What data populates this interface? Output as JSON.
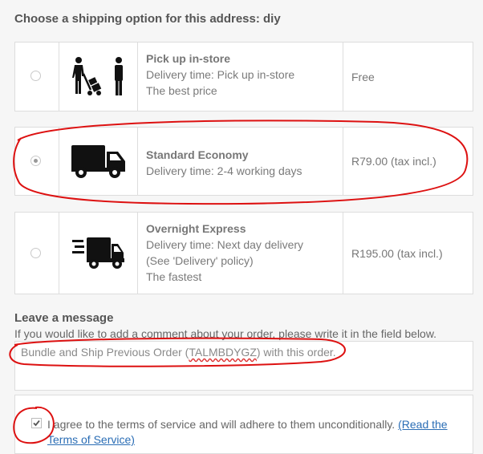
{
  "heading": "Choose a shipping option for this address: diy",
  "options": [
    {
      "name": "Pick up in-store",
      "line1": "Delivery time: Pick up in-store",
      "line2": "The best price",
      "line3": "",
      "price": "Free",
      "selected": false,
      "icon": "pickup-in-store-icon"
    },
    {
      "name": "Standard Economy",
      "line1": "Delivery time: 2-4 working days",
      "line2": "",
      "line3": "",
      "price": "R79.00 (tax incl.)",
      "selected": true,
      "icon": "delivery-truck-icon"
    },
    {
      "name": "Overnight Express",
      "line1": "Delivery time: Next day delivery",
      "line2": "(See 'Delivery' policy)",
      "line3": "The fastest",
      "price": "R195.00 (tax incl.)",
      "selected": false,
      "icon": "fast-truck-icon"
    }
  ],
  "message": {
    "title": "Leave a message",
    "help": "If you would like to add a comment about your order, please write it in the field below.",
    "value_prefix": "Bundle and Ship Previous Order (",
    "value_code": "TALMBDYGZ",
    "value_suffix": ") with this order."
  },
  "terms": {
    "text": "I agree to the terms of service and will adhere to them unconditionally. ",
    "link": "(Read the Terms of Service)",
    "checked": true
  },
  "colors": {
    "annotation": "#dd1111",
    "link": "#2a6db5"
  }
}
